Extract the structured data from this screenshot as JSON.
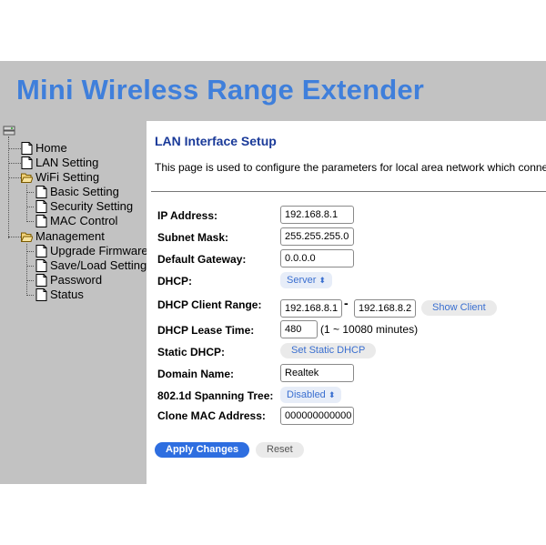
{
  "header": {
    "title": "Mini Wireless Range Extender"
  },
  "sidebar": {
    "items": [
      {
        "label": "Home"
      },
      {
        "label": "LAN Setting"
      },
      {
        "label": "WiFi Setting"
      },
      {
        "label": "Basic Setting"
      },
      {
        "label": "Security Setting"
      },
      {
        "label": "MAC Control"
      },
      {
        "label": "Management"
      },
      {
        "label": "Upgrade Firmware"
      },
      {
        "label": "Save/Load Setting"
      },
      {
        "label": "Password"
      },
      {
        "label": "Status"
      }
    ]
  },
  "main": {
    "title": "LAN Interface Setup",
    "description": "This page is used to configure the parameters for local area network which connects subnet mask, DHCP, etc..",
    "fields": {
      "ip_address": {
        "label": "IP Address:",
        "value": "192.168.8.1"
      },
      "subnet_mask": {
        "label": "Subnet Mask:",
        "value": "255.255.255.0"
      },
      "default_gateway": {
        "label": "Default Gateway:",
        "value": "0.0.0.0"
      },
      "dhcp": {
        "label": "DHCP:",
        "value": "Server"
      },
      "dhcp_client_range": {
        "label": "DHCP Client Range:",
        "start": "192.168.8.1",
        "separator": "-",
        "end": "192.168.8.2",
        "button": "Show Client"
      },
      "dhcp_lease_time": {
        "label": "DHCP Lease Time:",
        "value": "480",
        "note": "(1 ~ 10080 minutes)"
      },
      "static_dhcp": {
        "label": "Static DHCP:",
        "button": "Set Static DHCP"
      },
      "domain_name": {
        "label": "Domain Name:",
        "value": "Realtek"
      },
      "spanning_tree": {
        "label": "802.1d Spanning Tree:",
        "value": "Disabled"
      },
      "clone_mac": {
        "label": "Clone MAC Address:",
        "value": "000000000000"
      }
    },
    "apply_label": "Apply Changes",
    "reset_label": "Reset"
  },
  "colors": {
    "header_bg": "#c2c2c2",
    "title_blue": "#3f7fdb",
    "page_title": "#1a3a99",
    "primary_button": "#2e6ee0"
  },
  "icons": {
    "page": "document-icon",
    "folder": "folder-open-icon",
    "root": "computer-icon",
    "select": "chevron-updown-icon"
  }
}
